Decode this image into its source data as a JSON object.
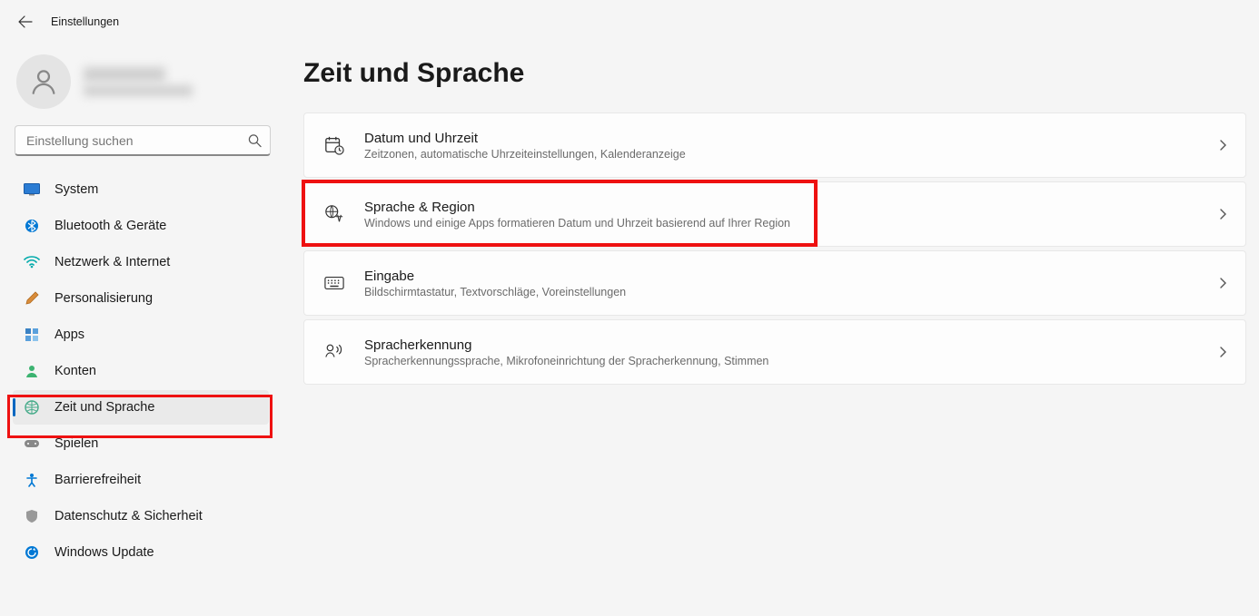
{
  "header": {
    "title": "Einstellungen"
  },
  "search": {
    "placeholder": "Einstellung suchen"
  },
  "nav": {
    "items": [
      {
        "label": "System"
      },
      {
        "label": "Bluetooth & Geräte"
      },
      {
        "label": "Netzwerk & Internet"
      },
      {
        "label": "Personalisierung"
      },
      {
        "label": "Apps"
      },
      {
        "label": "Konten"
      },
      {
        "label": "Zeit und Sprache"
      },
      {
        "label": "Spielen"
      },
      {
        "label": "Barrierefreiheit"
      },
      {
        "label": "Datenschutz & Sicherheit"
      },
      {
        "label": "Windows Update"
      }
    ],
    "active_index": 6
  },
  "page": {
    "title": "Zeit und Sprache",
    "cards": [
      {
        "title": "Datum und Uhrzeit",
        "desc": "Zeitzonen, automatische Uhrzeiteinstellungen, Kalenderanzeige"
      },
      {
        "title": "Sprache & Region",
        "desc": "Windows und einige Apps formatieren Datum und Uhrzeit basierend auf Ihrer Region"
      },
      {
        "title": "Eingabe",
        "desc": "Bildschirmtastatur, Textvorschläge, Voreinstellungen"
      },
      {
        "title": "Spracherkennung",
        "desc": "Spracherkennungssprache, Mikrofoneinrichtung der Spracherkennung, Stimmen"
      }
    ],
    "highlight_card_index": 1
  }
}
